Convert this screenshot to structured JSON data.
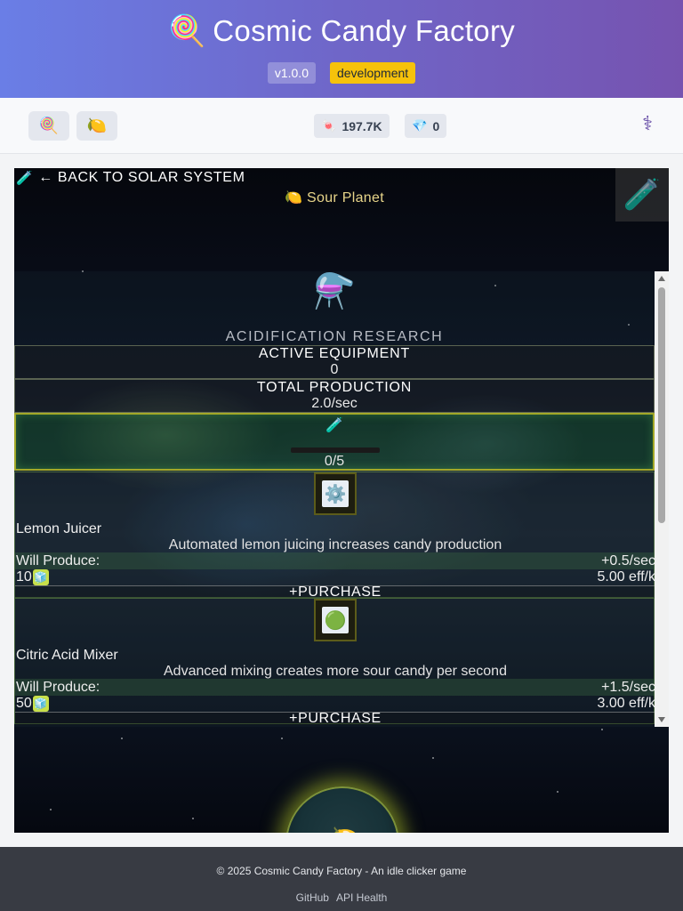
{
  "header": {
    "logo_icon": "🍭",
    "title": "Cosmic Candy Factory",
    "version": "v1.0.0",
    "environment": "development"
  },
  "toolbar": {
    "candy_button_icon": "🍭",
    "lemon_button_icon": "🍋",
    "candy_stat": {
      "icon": "🍬",
      "value": "197.7K"
    },
    "gem_stat": {
      "icon": "💎",
      "value": "0"
    },
    "right_icon": "⚕"
  },
  "game": {
    "back_icon": "🧪",
    "back_label": "← BACK TO SOLAR SYSTEM",
    "planet_icon": "🍋",
    "planet_name": "Sour Planet",
    "corner_icon": "🧪",
    "panel": {
      "research_icon": "⚗️",
      "research_title": "ACIDIFICATION RESEARCH",
      "active_equipment_label": "ACTIVE EQUIPMENT",
      "active_equipment_value": "0",
      "total_production_label": "TOTAL PRODUCTION",
      "total_production_value": "2.0/sec",
      "progress_icon": "🧪",
      "progress_fraction": 0,
      "progress_text": "0/5",
      "upgrades": [
        {
          "icon": "⚙️",
          "name": "Lemon Juicer",
          "description": "Automated lemon juicing increases candy production",
          "produce_label": "Will Produce:",
          "produce_value": "+0.5/sec",
          "cost": "10",
          "cost_icon": "🧊",
          "efficiency": "5.00 eff/k",
          "button": "+PURCHASE"
        },
        {
          "icon": "🟢",
          "name": "Citric Acid Mixer",
          "description": "Advanced mixing creates more sour candy per second",
          "produce_label": "Will Produce:",
          "produce_value": "+1.5/sec",
          "cost": "50",
          "cost_icon": "🧊",
          "efficiency": "3.00 eff/k",
          "button": "+PURCHASE"
        }
      ]
    },
    "planet_orb_icon": "🍋"
  },
  "footer": {
    "copyright": "© 2025 Cosmic Candy Factory - An idle clicker game",
    "links": [
      "GitHub",
      "API Health"
    ]
  }
}
